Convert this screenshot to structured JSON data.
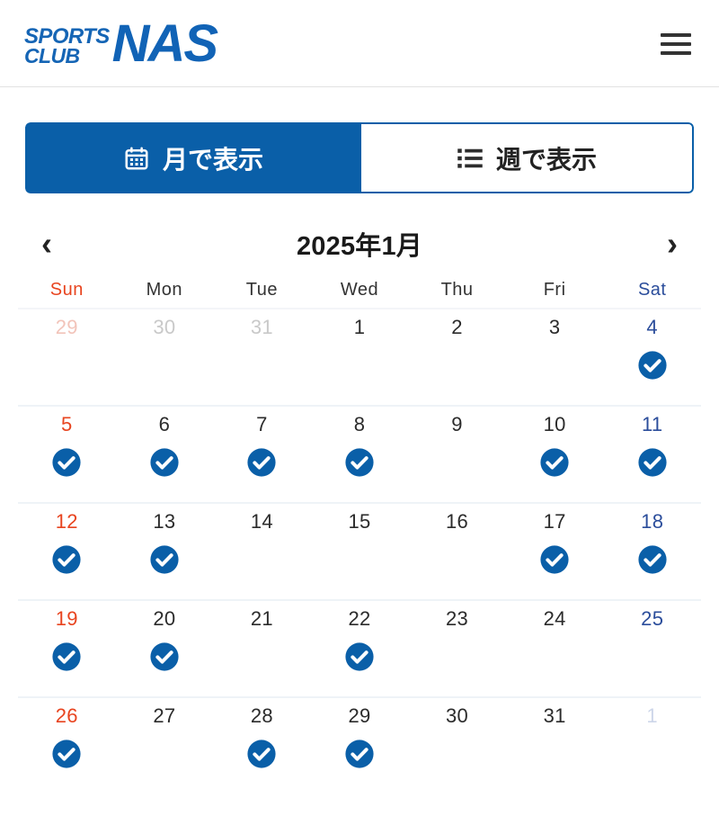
{
  "header": {
    "logo": {
      "line1": "SPORTS",
      "line2": "CLUB",
      "mark": "NAS",
      "icon_name": "sports-club-nas-logo"
    },
    "menu_icon_name": "hamburger-menu-icon"
  },
  "tabs": [
    {
      "label": "月で表示",
      "icon": "calendar-icon",
      "active": true
    },
    {
      "label": "週で表示",
      "icon": "list-icon",
      "active": false
    }
  ],
  "month_nav": {
    "prev_label": "‹",
    "next_label": "›",
    "current_month": "2025年1月"
  },
  "weekdays": [
    {
      "label": "Sun",
      "kind": "sun"
    },
    {
      "label": "Mon",
      "kind": "day"
    },
    {
      "label": "Tue",
      "kind": "day"
    },
    {
      "label": "Wed",
      "kind": "day"
    },
    {
      "label": "Thu",
      "kind": "day"
    },
    {
      "label": "Fri",
      "kind": "day"
    },
    {
      "label": "Sat",
      "kind": "sat"
    }
  ],
  "colors": {
    "brand_blue": "#0a5fa8",
    "logo_blue": "#1163b6",
    "sunday_red": "#e8441f",
    "saturday_blue": "#2b4d9b",
    "check_blue": "#0a5fa8",
    "row_divider": "#eef3f7"
  },
  "calendar": {
    "weeks": [
      [
        {
          "num": "29",
          "kind": "sun",
          "other_month": true,
          "checked": false
        },
        {
          "num": "30",
          "kind": "day",
          "other_month": true,
          "checked": false
        },
        {
          "num": "31",
          "kind": "day",
          "other_month": true,
          "checked": false
        },
        {
          "num": "1",
          "kind": "day",
          "other_month": false,
          "checked": false
        },
        {
          "num": "2",
          "kind": "day",
          "other_month": false,
          "checked": false
        },
        {
          "num": "3",
          "kind": "day",
          "other_month": false,
          "checked": false
        },
        {
          "num": "4",
          "kind": "sat",
          "other_month": false,
          "checked": true
        }
      ],
      [
        {
          "num": "5",
          "kind": "sun",
          "other_month": false,
          "checked": true
        },
        {
          "num": "6",
          "kind": "day",
          "other_month": false,
          "checked": true
        },
        {
          "num": "7",
          "kind": "day",
          "other_month": false,
          "checked": true
        },
        {
          "num": "8",
          "kind": "day",
          "other_month": false,
          "checked": true
        },
        {
          "num": "9",
          "kind": "day",
          "other_month": false,
          "checked": false
        },
        {
          "num": "10",
          "kind": "day",
          "other_month": false,
          "checked": true
        },
        {
          "num": "11",
          "kind": "sat",
          "other_month": false,
          "checked": true
        }
      ],
      [
        {
          "num": "12",
          "kind": "sun",
          "other_month": false,
          "checked": true
        },
        {
          "num": "13",
          "kind": "day",
          "other_month": false,
          "checked": true
        },
        {
          "num": "14",
          "kind": "day",
          "other_month": false,
          "checked": false
        },
        {
          "num": "15",
          "kind": "day",
          "other_month": false,
          "checked": false
        },
        {
          "num": "16",
          "kind": "day",
          "other_month": false,
          "checked": false
        },
        {
          "num": "17",
          "kind": "day",
          "other_month": false,
          "checked": true
        },
        {
          "num": "18",
          "kind": "sat",
          "other_month": false,
          "checked": true
        }
      ],
      [
        {
          "num": "19",
          "kind": "sun",
          "other_month": false,
          "checked": true
        },
        {
          "num": "20",
          "kind": "day",
          "other_month": false,
          "checked": true
        },
        {
          "num": "21",
          "kind": "day",
          "other_month": false,
          "checked": false
        },
        {
          "num": "22",
          "kind": "day",
          "other_month": false,
          "checked": true
        },
        {
          "num": "23",
          "kind": "day",
          "other_month": false,
          "checked": false
        },
        {
          "num": "24",
          "kind": "day",
          "other_month": false,
          "checked": false
        },
        {
          "num": "25",
          "kind": "sat",
          "other_month": false,
          "checked": false
        }
      ],
      [
        {
          "num": "26",
          "kind": "sun",
          "other_month": false,
          "checked": true
        },
        {
          "num": "27",
          "kind": "day",
          "other_month": false,
          "checked": false
        },
        {
          "num": "28",
          "kind": "day",
          "other_month": false,
          "checked": true
        },
        {
          "num": "29",
          "kind": "day",
          "other_month": false,
          "checked": true
        },
        {
          "num": "30",
          "kind": "day",
          "other_month": false,
          "checked": false
        },
        {
          "num": "31",
          "kind": "day",
          "other_month": false,
          "checked": false
        },
        {
          "num": "1",
          "kind": "sat",
          "other_month": true,
          "checked": false
        }
      ]
    ]
  }
}
